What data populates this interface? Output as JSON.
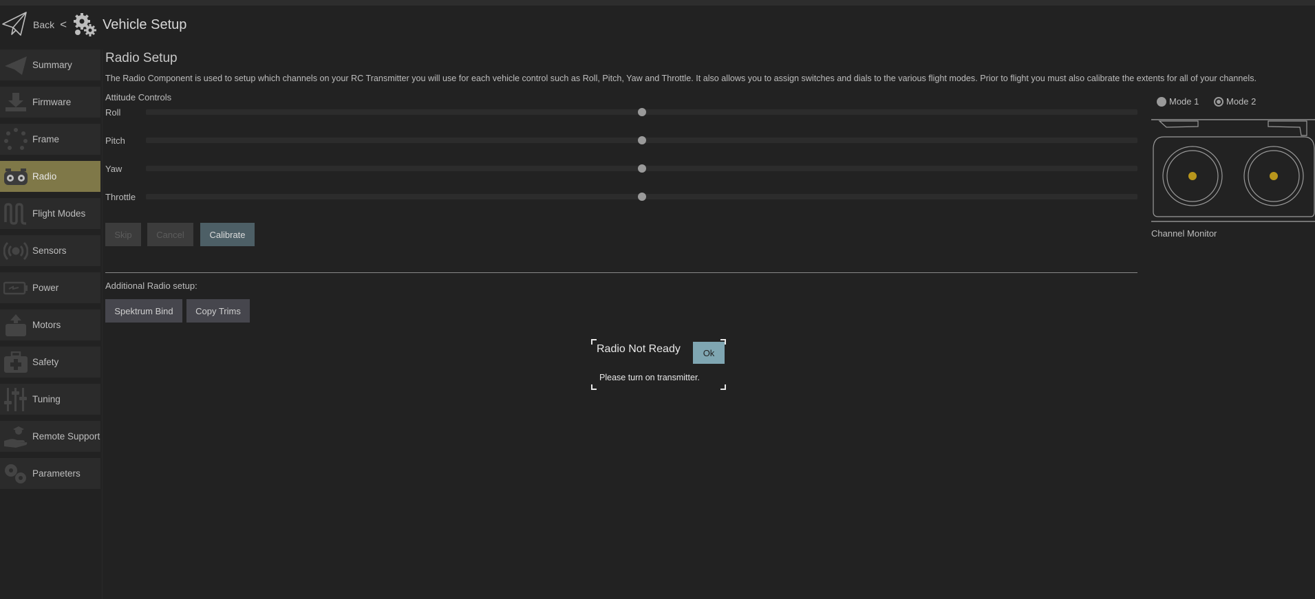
{
  "header": {
    "back_label": "Back",
    "chevron": "<",
    "title": "Vehicle Setup",
    "gears_icon": "gears-icon",
    "plane_icon": "paper-plane-icon"
  },
  "sidebar": {
    "items": [
      {
        "label": "Summary",
        "icon": "paper-plane-icon",
        "active": false
      },
      {
        "label": "Firmware",
        "icon": "download-icon",
        "active": false
      },
      {
        "label": "Frame",
        "icon": "frame-dots-icon",
        "active": false
      },
      {
        "label": "Radio",
        "icon": "radio-transmitter-icon",
        "active": true
      },
      {
        "label": "Flight Modes",
        "icon": "wave-icon",
        "active": false
      },
      {
        "label": "Sensors",
        "icon": "sensor-waves-icon",
        "active": false
      },
      {
        "label": "Power",
        "icon": "battery-icon",
        "active": false
      },
      {
        "label": "Motors",
        "icon": "motor-icon",
        "active": false
      },
      {
        "label": "Safety",
        "icon": "first-aid-kit-icon",
        "active": false
      },
      {
        "label": "Tuning",
        "icon": "sliders-icon",
        "active": false
      },
      {
        "label": "Remote Support",
        "icon": "helping-hand-icon",
        "active": false
      },
      {
        "label": "Parameters",
        "icon": "gears-icon",
        "active": false
      }
    ],
    "active_color": "#7f7848"
  },
  "main": {
    "title": "Radio Setup",
    "description": "The Radio Component is used to setup which channels on your RC Transmitter you will use for each vehicle control such as Roll, Pitch, Yaw and Throttle. It also allows you to assign switches and dials to the various flight modes. Prior to flight you must also calibrate the extents for all of your channels.",
    "attitude_label": "Attitude Controls",
    "channels": [
      {
        "label": "Roll",
        "value": 0.5
      },
      {
        "label": "Pitch",
        "value": 0.5
      },
      {
        "label": "Yaw",
        "value": 0.5
      },
      {
        "label": "Throttle",
        "value": 0.5
      }
    ],
    "buttons": {
      "skip": "Skip",
      "cancel": "Cancel",
      "calibrate": "Calibrate"
    },
    "additional_label": "Additional Radio setup:",
    "additional_buttons": {
      "spektrum": "Spektrum Bind",
      "copy_trims": "Copy Trims"
    }
  },
  "transmitter": {
    "mode1_label": "Mode 1",
    "mode2_label": "Mode 2",
    "selected_mode": "Mode 2",
    "channel_monitor_label": "Channel Monitor",
    "stick_color": "#b8961c"
  },
  "dialog": {
    "title": "Radio Not Ready",
    "ok_label": "Ok",
    "message": "Please turn on transmitter."
  }
}
